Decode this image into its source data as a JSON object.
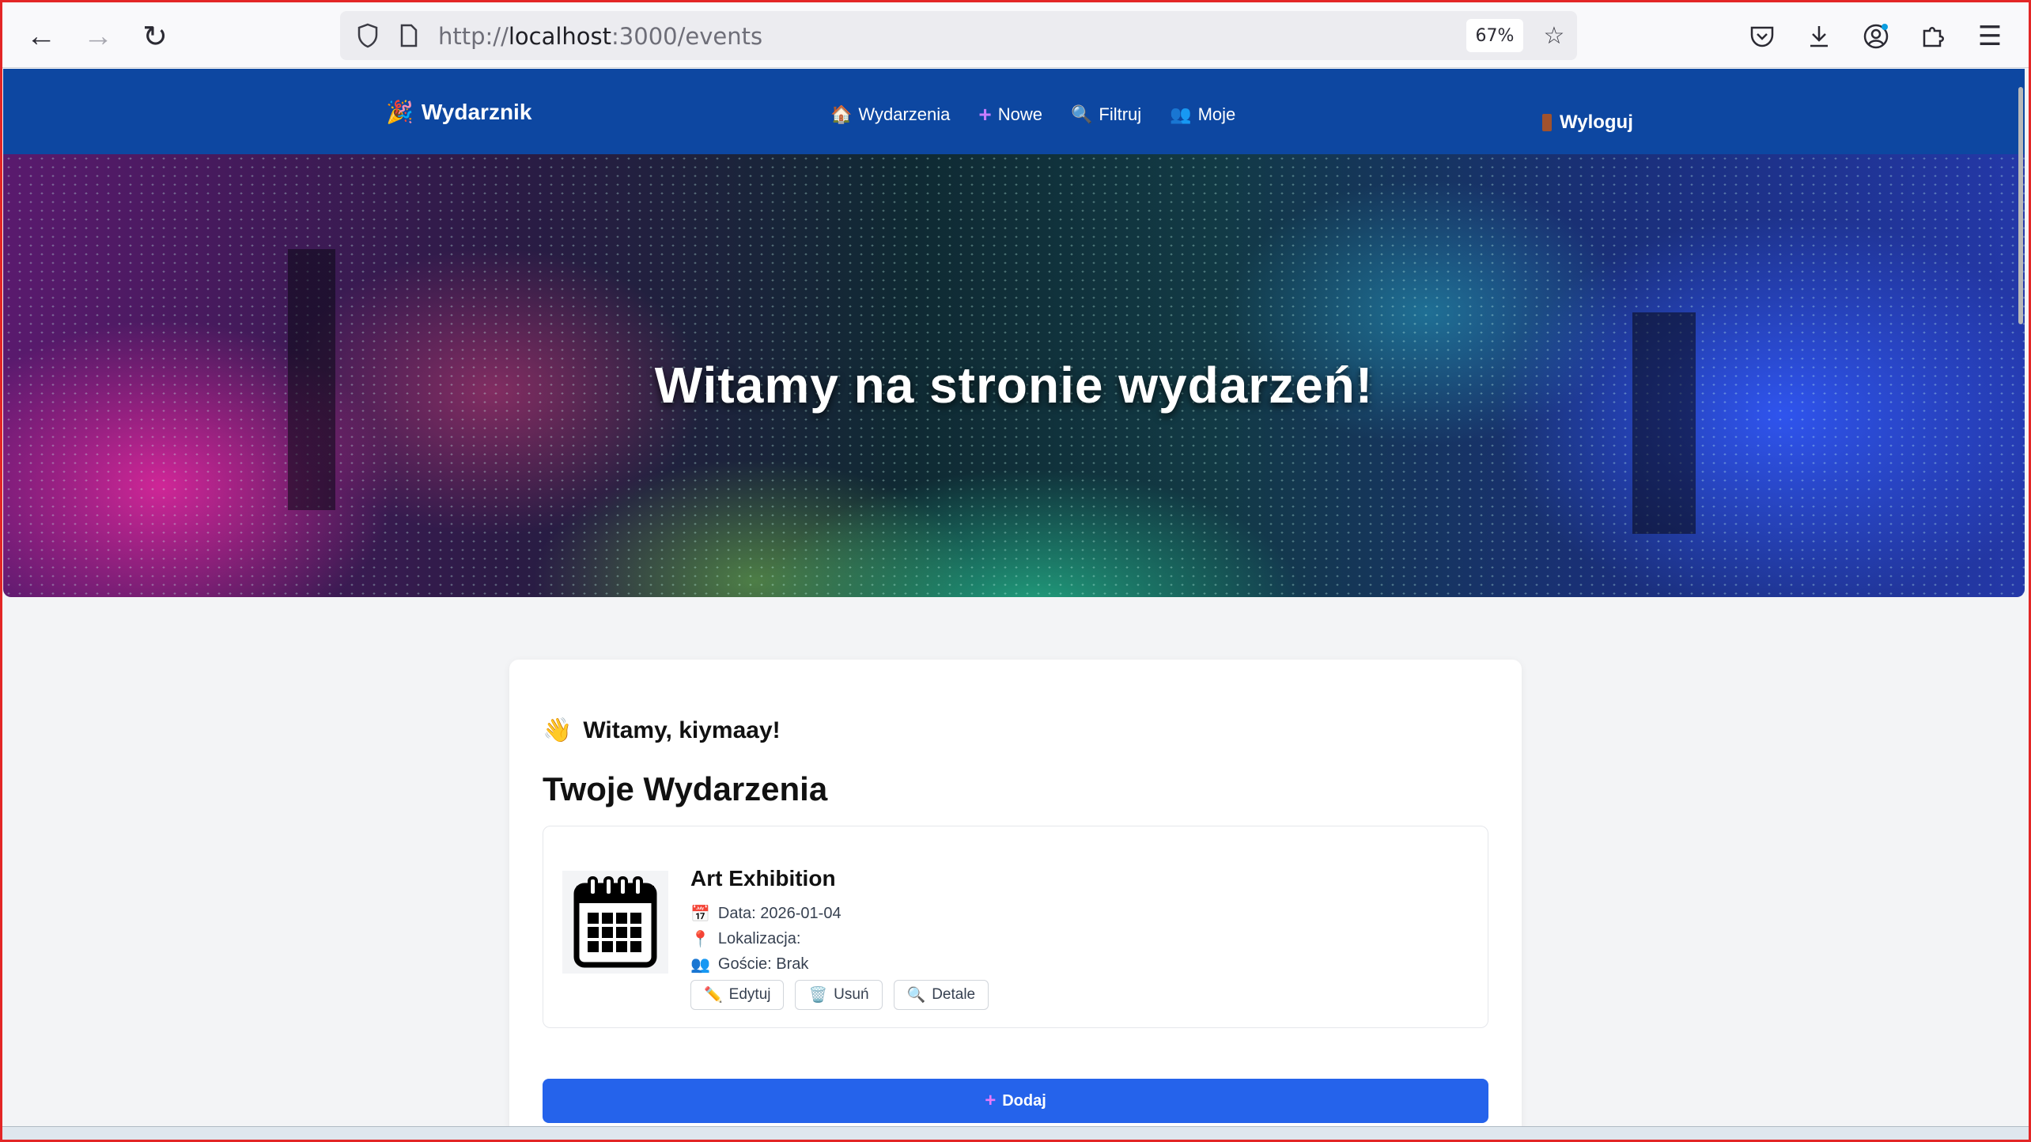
{
  "browser": {
    "url_prefix": "http://",
    "url_host": "localhost",
    "url_path": ":3000/events",
    "zoom": "67%"
  },
  "navbar": {
    "brand": "Wydarznik",
    "links": [
      {
        "label": "Wydarzenia",
        "icon": "house-icon"
      },
      {
        "label": "Nowe",
        "icon": "plus-icon"
      },
      {
        "label": "Filtruj",
        "icon": "magnifier-icon"
      },
      {
        "label": "Moje",
        "icon": "people-icon"
      }
    ],
    "logout": "Wyloguj"
  },
  "hero": {
    "title": "Witamy na stronie wydarzeń!"
  },
  "main": {
    "welcome": "Witamy, kiymaay!",
    "section_title": "Twoje Wydarzenia",
    "events": [
      {
        "title": "Art Exhibition",
        "date": "Data: 2026-01-04",
        "location": "Lokalizacja:",
        "guests": "Goście: Brak",
        "actions": {
          "edit": "Edytuj",
          "delete": "Usuń",
          "details": "Detale"
        }
      }
    ],
    "add_button": "Dodaj"
  },
  "colors": {
    "navbar_bg": "#0d47a1",
    "primary_button": "#2563eb",
    "page_bg": "#f3f4f6"
  }
}
